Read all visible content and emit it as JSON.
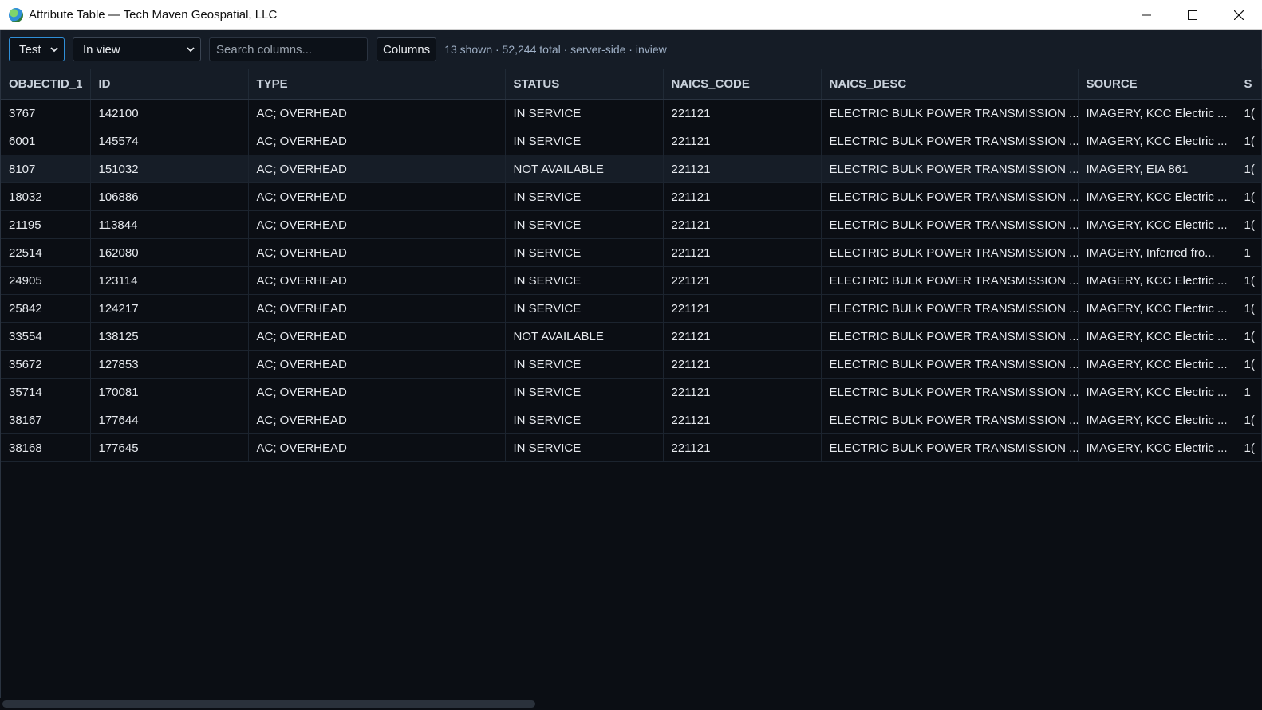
{
  "window": {
    "title": "Attribute Table — Tech Maven Geospatial, LLC",
    "controls": [
      "minimize-icon",
      "maximize-icon",
      "close-icon"
    ]
  },
  "toolbar": {
    "layer_select": "Test",
    "extent_select": "In view",
    "search_placeholder": "Search columns...",
    "columns_button": "Columns",
    "status": "13 shown · 52,244 total · server-side · inview"
  },
  "table": {
    "columns": [
      "OBJECTID_1",
      "ID",
      "TYPE",
      "STATUS",
      "NAICS_CODE",
      "NAICS_DESC",
      "SOURCE",
      "S"
    ],
    "rows": [
      [
        "3767",
        "142100",
        "AC; OVERHEAD",
        "IN SERVICE",
        "221121",
        "ELECTRIC BULK POWER TRANSMISSION ...",
        "IMAGERY, KCC Electric ...",
        "1("
      ],
      [
        "6001",
        "145574",
        "AC; OVERHEAD",
        "IN SERVICE",
        "221121",
        "ELECTRIC BULK POWER TRANSMISSION ...",
        "IMAGERY, KCC Electric ...",
        "1("
      ],
      [
        "8107",
        "151032",
        "AC; OVERHEAD",
        "NOT AVAILABLE",
        "221121",
        "ELECTRIC BULK POWER TRANSMISSION ...",
        "IMAGERY, EIA 861",
        "1("
      ],
      [
        "18032",
        "106886",
        "AC; OVERHEAD",
        "IN SERVICE",
        "221121",
        "ELECTRIC BULK POWER TRANSMISSION ...",
        "IMAGERY, KCC Electric ...",
        "1("
      ],
      [
        "21195",
        "113844",
        "AC; OVERHEAD",
        "IN SERVICE",
        "221121",
        "ELECTRIC BULK POWER TRANSMISSION ...",
        "IMAGERY, KCC Electric ...",
        "1("
      ],
      [
        "22514",
        "162080",
        "AC; OVERHEAD",
        "IN SERVICE",
        "221121",
        "ELECTRIC BULK POWER TRANSMISSION ...",
        "IMAGERY, Inferred fro...",
        "1"
      ],
      [
        "24905",
        "123114",
        "AC; OVERHEAD",
        "IN SERVICE",
        "221121",
        "ELECTRIC BULK POWER TRANSMISSION ...",
        "IMAGERY, KCC Electric ...",
        "1("
      ],
      [
        "25842",
        "124217",
        "AC; OVERHEAD",
        "IN SERVICE",
        "221121",
        "ELECTRIC BULK POWER TRANSMISSION ...",
        "IMAGERY, KCC Electric ...",
        "1("
      ],
      [
        "33554",
        "138125",
        "AC; OVERHEAD",
        "NOT AVAILABLE",
        "221121",
        "ELECTRIC BULK POWER TRANSMISSION ...",
        "IMAGERY, KCC Electric ...",
        "1("
      ],
      [
        "35672",
        "127853",
        "AC; OVERHEAD",
        "IN SERVICE",
        "221121",
        "ELECTRIC BULK POWER TRANSMISSION ...",
        "IMAGERY, KCC Electric ...",
        "1("
      ],
      [
        "35714",
        "170081",
        "AC; OVERHEAD",
        "IN SERVICE",
        "221121",
        "ELECTRIC BULK POWER TRANSMISSION ...",
        "IMAGERY, KCC Electric ...",
        "1"
      ],
      [
        "38167",
        "177644",
        "AC; OVERHEAD",
        "IN SERVICE",
        "221121",
        "ELECTRIC BULK POWER TRANSMISSION ...",
        "IMAGERY, KCC Electric ...",
        "1("
      ],
      [
        "38168",
        "177645",
        "AC; OVERHEAD",
        "IN SERVICE",
        "221121",
        "ELECTRIC BULK POWER TRANSMISSION ...",
        "IMAGERY, KCC Electric ...",
        "1("
      ]
    ],
    "selected_row": 2
  },
  "colors": {
    "accent": "#2f8fd8",
    "background": "#0b0e14",
    "toolbar": "#151c26"
  }
}
